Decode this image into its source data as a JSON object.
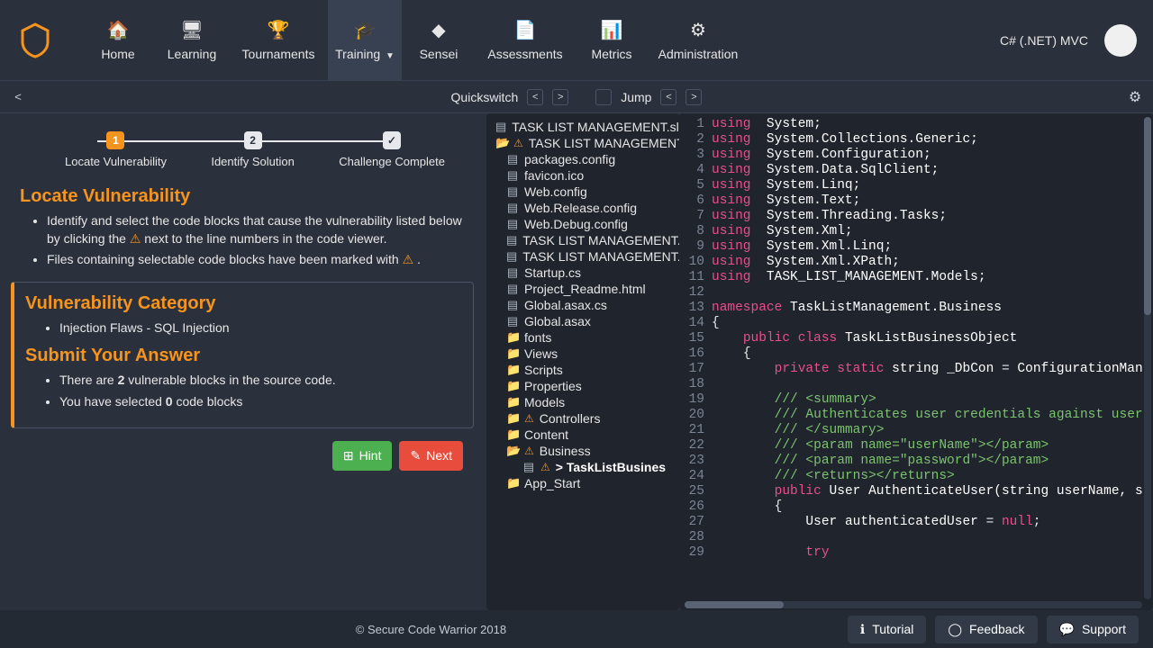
{
  "nav": {
    "items": [
      {
        "icon": "🏠",
        "label": "Home"
      },
      {
        "icon": "🖥",
        "label": "Learning"
      },
      {
        "icon": "🏆",
        "label": "Tournaments"
      },
      {
        "icon": "🎓",
        "label": "Training",
        "active": true,
        "caret": true
      },
      {
        "icon": "◆",
        "label": "Sensei"
      },
      {
        "icon": "📄",
        "label": "Assessments"
      },
      {
        "icon": "📊",
        "label": "Metrics"
      },
      {
        "icon": "⚙",
        "label": "Administration"
      }
    ],
    "language": "C# (.NET) MVC"
  },
  "toolbar": {
    "quickswitch": "Quickswitch",
    "jump": "Jump"
  },
  "stepper": {
    "steps": [
      {
        "num": "1",
        "label": "Locate Vulnerability",
        "kind": "active"
      },
      {
        "num": "2",
        "label": "Identify Solution",
        "kind": "neutral"
      },
      {
        "num": "✓",
        "label": "Challenge Complete",
        "kind": "neutral"
      }
    ]
  },
  "instructions": {
    "title": "Locate Vulnerability",
    "line1_a": "Identify and select the code blocks that cause the vulnerability listed below by clicking the ",
    "line1_b": " next to the line numbers in the code viewer.",
    "line2_a": "Files containing selectable code blocks have been marked with ",
    "line2_b": "."
  },
  "answer": {
    "cat_title": "Vulnerability Category",
    "cat_item": "Injection Flaws - SQL Injection",
    "submit_title": "Submit Your Answer",
    "count_a": "There are ",
    "count_n": "2",
    "count_b": " vulnerable blocks in the source code.",
    "sel_a": "You have selected ",
    "sel_n": "0",
    "sel_b": " code blocks"
  },
  "buttons": {
    "hint": "Hint",
    "next": "Next"
  },
  "tree": [
    {
      "indent": 0,
      "icon": "file",
      "warn": false,
      "name": "TASK LIST MANAGEMENT.sln"
    },
    {
      "indent": 0,
      "icon": "folder-open",
      "warn": true,
      "name": "TASK LIST MANAGEMENT"
    },
    {
      "indent": 1,
      "icon": "file",
      "name": "packages.config"
    },
    {
      "indent": 1,
      "icon": "file",
      "name": "favicon.ico"
    },
    {
      "indent": 1,
      "icon": "file",
      "name": "Web.config"
    },
    {
      "indent": 1,
      "icon": "file",
      "name": "Web.Release.config"
    },
    {
      "indent": 1,
      "icon": "file",
      "name": "Web.Debug.config"
    },
    {
      "indent": 1,
      "icon": "file",
      "name": "TASK LIST MANAGEMENT."
    },
    {
      "indent": 1,
      "icon": "file",
      "name": "TASK LIST MANAGEMENT."
    },
    {
      "indent": 1,
      "icon": "file",
      "name": "Startup.cs"
    },
    {
      "indent": 1,
      "icon": "file",
      "name": "Project_Readme.html"
    },
    {
      "indent": 1,
      "icon": "file",
      "name": "Global.asax.cs"
    },
    {
      "indent": 1,
      "icon": "file",
      "name": "Global.asax"
    },
    {
      "indent": 1,
      "icon": "folder",
      "name": "fonts"
    },
    {
      "indent": 1,
      "icon": "folder",
      "name": "Views"
    },
    {
      "indent": 1,
      "icon": "folder",
      "name": "Scripts"
    },
    {
      "indent": 1,
      "icon": "folder",
      "name": "Properties"
    },
    {
      "indent": 1,
      "icon": "folder",
      "name": "Models"
    },
    {
      "indent": 1,
      "icon": "folder",
      "warn": true,
      "name": "Controllers"
    },
    {
      "indent": 1,
      "icon": "folder",
      "name": "Content"
    },
    {
      "indent": 1,
      "icon": "folder-open",
      "warn": true,
      "name": "Business"
    },
    {
      "indent": 2,
      "icon": "file",
      "warn": true,
      "name": "> TaskListBusines",
      "selected": true
    },
    {
      "indent": 1,
      "icon": "folder",
      "name": "App_Start"
    }
  ],
  "code": [
    {
      "n": 1,
      "html": "<span class='kw'>using</span>  <span class='ns'>System;</span>"
    },
    {
      "n": 2,
      "html": "<span class='kw'>using</span>  <span class='ns'>System.Collections.Generic;</span>"
    },
    {
      "n": 3,
      "html": "<span class='kw'>using</span>  <span class='ns'>System.Configuration;</span>"
    },
    {
      "n": 4,
      "html": "<span class='kw'>using</span>  <span class='ns'>System.Data.SqlClient;</span>"
    },
    {
      "n": 5,
      "html": "<span class='kw'>using</span>  <span class='ns'>System.Linq;</span>"
    },
    {
      "n": 6,
      "html": "<span class='kw'>using</span>  <span class='ns'>System.Text;</span>"
    },
    {
      "n": 7,
      "html": "<span class='kw'>using</span>  <span class='ns'>System.Threading.Tasks;</span>"
    },
    {
      "n": 8,
      "html": "<span class='kw'>using</span>  <span class='ns'>System.Xml;</span>"
    },
    {
      "n": 9,
      "html": "<span class='kw'>using</span>  <span class='ns'>System.Xml.Linq;</span>"
    },
    {
      "n": 10,
      "html": "<span class='kw'>using</span>  <span class='ns'>System.Xml.XPath;</span>"
    },
    {
      "n": 11,
      "html": "<span class='kw'>using</span>  <span class='ns'>TASK_LIST_MANAGEMENT.Models;</span>"
    },
    {
      "n": 12,
      "html": ""
    },
    {
      "n": 13,
      "html": "<span class='cls'>namespace</span> <span class='ns'>TaskListManagement.Business</span>"
    },
    {
      "n": 14,
      "html": "<span class='op'>{</span>"
    },
    {
      "n": 15,
      "html": "    <span class='pub'>public</span> <span class='cls'>class</span> <span class='type'>TaskListBusinessObject</span>"
    },
    {
      "n": 16,
      "html": "    <span class='op'>{</span>"
    },
    {
      "n": 17,
      "html": "        <span class='pub'>private</span> <span class='pub'>static</span> <span class='type'>string</span> <span class='ns'>_DbCon</span> <span class='op'>=</span> <span class='ns'>ConfigurationMan</span>"
    },
    {
      "n": 18,
      "html": ""
    },
    {
      "n": 19,
      "html": "        <span class='cmt'>/// &lt;summary&gt;</span>"
    },
    {
      "n": 20,
      "html": "        <span class='cmt'>/// Authenticates user credentials against user</span>"
    },
    {
      "n": 21,
      "html": "        <span class='cmt'>/// &lt;/summary&gt;</span>"
    },
    {
      "n": 22,
      "html": "        <span class='cmt'>/// &lt;param name=&quot;userName&quot;&gt;&lt;/param&gt;</span>"
    },
    {
      "n": 23,
      "html": "        <span class='cmt'>/// &lt;param name=&quot;password&quot;&gt;&lt;/param&gt;</span>"
    },
    {
      "n": 24,
      "html": "        <span class='cmt'>/// &lt;returns&gt;&lt;/returns&gt;</span>"
    },
    {
      "n": 25,
      "html": "        <span class='pub'>public</span> <span class='type'>User</span> <span class='ns'>AuthenticateUser(</span><span class='type'>string</span> <span class='ns'>userName,</span> <span class='type'>s</span>"
    },
    {
      "n": 26,
      "html": "        <span class='op'>{</span>"
    },
    {
      "n": 27,
      "html": "            <span class='type'>User</span> <span class='ns'>authenticatedUser</span> <span class='op'>=</span> <span class='kw'>null</span><span class='op'>;</span>"
    },
    {
      "n": 28,
      "html": ""
    },
    {
      "n": 29,
      "html": "            <span class='pub'>try</span>"
    }
  ],
  "footer": {
    "copyright": "© Secure Code Warrior 2018",
    "tutorial": "Tutorial",
    "feedback": "Feedback",
    "support": "Support"
  }
}
